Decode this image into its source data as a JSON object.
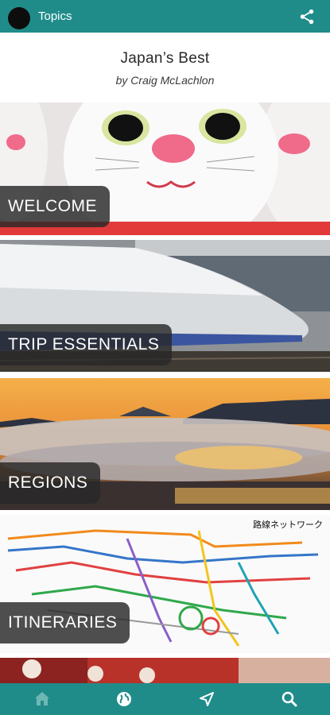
{
  "app_bar": {
    "title": "Topics",
    "avatar_icon": "avatar",
    "share_icon": "share-icon"
  },
  "book": {
    "title": "Japan’s Best",
    "author": "by Craig McLachlon"
  },
  "topics": [
    {
      "label": "WELCOME",
      "image": "lucky-cat-figurines"
    },
    {
      "label": "TRIP ESSENTIALS",
      "image": "bullet-train"
    },
    {
      "label": "REGIONS",
      "image": "mount-fuji-sea-of-clouds"
    },
    {
      "label": "ITINERARIES",
      "image": "rail-network-map"
    },
    {
      "label": "",
      "image": "geisha-partial"
    }
  ],
  "map": {
    "title": "路線ネットワーク"
  },
  "bottom_nav": [
    {
      "name": "home",
      "icon": "home-icon",
      "active": false
    },
    {
      "name": "globe",
      "icon": "globe-icon",
      "active": true
    },
    {
      "name": "navigate",
      "icon": "navigation-arrow-icon",
      "active": true
    },
    {
      "name": "search",
      "icon": "search-icon",
      "active": true
    }
  ],
  "colors": {
    "accent": "#1f8c8a",
    "label_bg": "#2b2b2b",
    "inactive_icon": "#6fb7b5"
  }
}
